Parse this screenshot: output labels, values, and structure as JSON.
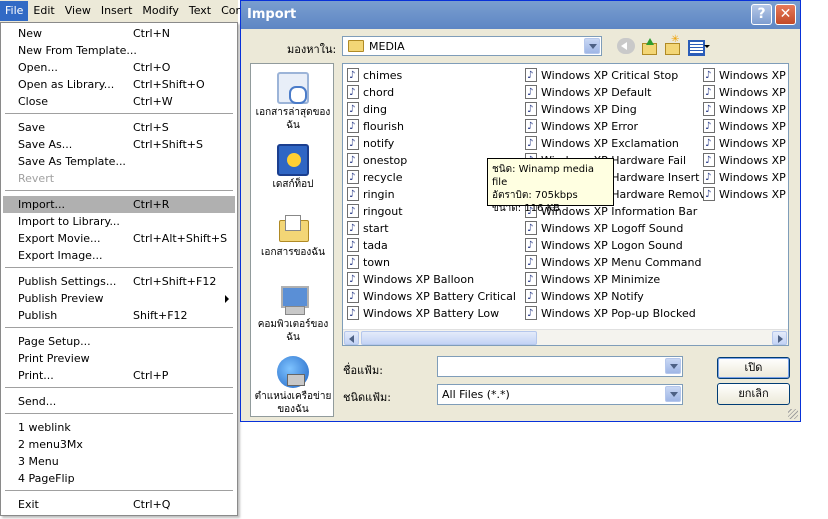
{
  "menubar": {
    "items": [
      "File",
      "Edit",
      "View",
      "Insert",
      "Modify",
      "Text",
      "Contr"
    ]
  },
  "file_menu": {
    "items": [
      {
        "label": "New",
        "shortcut": "Ctrl+N"
      },
      {
        "label": "New From Template...",
        "shortcut": ""
      },
      {
        "label": "Open...",
        "shortcut": "Ctrl+O"
      },
      {
        "label": "Open as Library...",
        "shortcut": "Ctrl+Shift+O"
      },
      {
        "label": "Close",
        "shortcut": "Ctrl+W"
      },
      {
        "label": "Save",
        "shortcut": "Ctrl+S"
      },
      {
        "label": "Save As...",
        "shortcut": "Ctrl+Shift+S"
      },
      {
        "label": "Save As Template...",
        "shortcut": ""
      },
      {
        "label": "Revert",
        "shortcut": ""
      },
      {
        "label": "Import...",
        "shortcut": "Ctrl+R"
      },
      {
        "label": "Import to Library...",
        "shortcut": ""
      },
      {
        "label": "Export Movie...",
        "shortcut": "Ctrl+Alt+Shift+S"
      },
      {
        "label": "Export Image...",
        "shortcut": ""
      },
      {
        "label": "Publish Settings...",
        "shortcut": "Ctrl+Shift+F12"
      },
      {
        "label": "Publish Preview",
        "shortcut": ""
      },
      {
        "label": "Publish",
        "shortcut": "Shift+F12"
      },
      {
        "label": "Page Setup...",
        "shortcut": ""
      },
      {
        "label": "Print Preview",
        "shortcut": ""
      },
      {
        "label": "Print...",
        "shortcut": "Ctrl+P"
      },
      {
        "label": "Send...",
        "shortcut": ""
      },
      {
        "label": "1 weblink",
        "shortcut": ""
      },
      {
        "label": "2 menu3Mx",
        "shortcut": ""
      },
      {
        "label": "3 Menu",
        "shortcut": ""
      },
      {
        "label": "4 PageFlip",
        "shortcut": ""
      },
      {
        "label": "Exit",
        "shortcut": "Ctrl+Q"
      }
    ]
  },
  "dialog": {
    "title": "Import",
    "help_label": "?",
    "close_label": "✕",
    "look_in_label": "มองหาใน:",
    "look_in_value": "MEDIA",
    "places": [
      "เอกสารล่าสุดของฉัน",
      "เดสก์ท็อป",
      "เอกสารของฉัน",
      "คอมพิวเตอร์ของฉัน",
      "ตำแหน่งเครือข่ายของฉัน"
    ],
    "files": {
      "col1": [
        "chimes",
        "chord",
        "ding",
        "flourish",
        "notify",
        "onestop",
        "recycle",
        "ringin",
        "ringout",
        "start",
        "tada",
        "town",
        "Windows XP Balloon",
        "Windows XP Battery Critical",
        "Windows XP Battery Low"
      ],
      "col2": [
        "Windows XP Critical Stop",
        "Windows XP Default",
        "Windows XP Ding",
        "Windows XP Error",
        "Windows XP Exclamation",
        "Windows XP Hardware Fail",
        "Windows XP Hardware Insert",
        "Windows XP Hardware Remove",
        "Windows XP Information Bar",
        "Windows XP Logoff Sound",
        "Windows XP Logon Sound",
        "Windows XP Menu Command",
        "Windows XP Minimize",
        "Windows XP Notify",
        "Windows XP Pop-up Blocked"
      ],
      "col3": [
        "Windows XP Pri",
        "Windows XP Re",
        "Windows XP Re",
        "Windows XP Rin",
        "Windows XP Rin",
        "Windows XP Sh",
        "Windows XP St",
        "Windows XP St"
      ]
    },
    "tooltip": [
      "ชนิด: Winamp media file",
      "อัตราบิต: 705kbps",
      "ขนาด: 116 KB"
    ],
    "filename_label": "ชื่อแฟ้ม:",
    "filename_value": "",
    "filetype_label": "ชนิดแฟ้ม:",
    "filetype_value": "All Files (*.*)",
    "open_label": "เปิด",
    "cancel_label": "ยกเลิก"
  }
}
